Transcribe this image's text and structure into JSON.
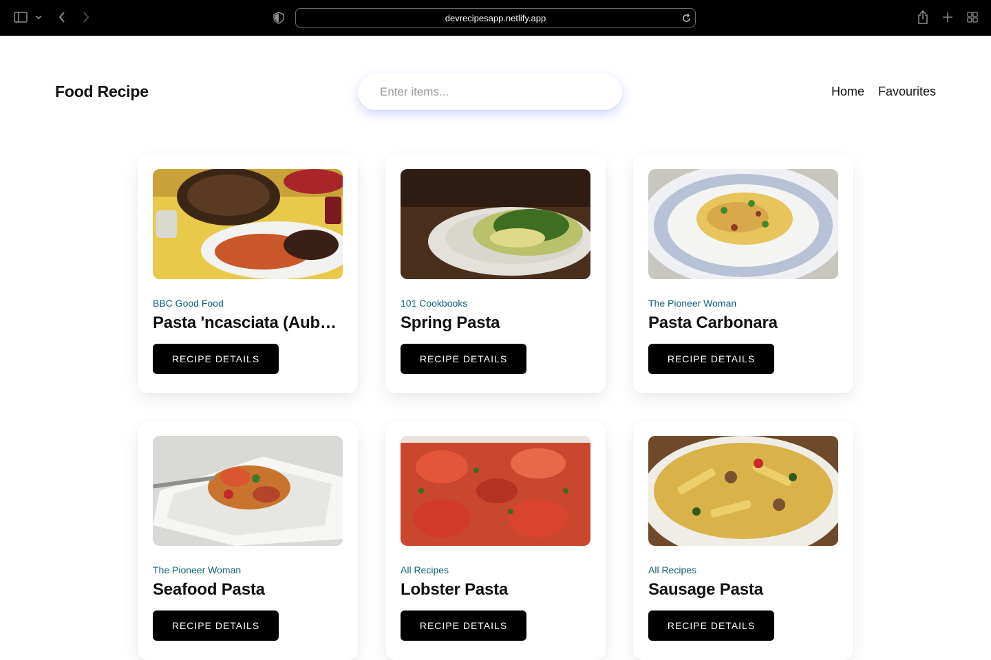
{
  "browser": {
    "url": "devrecipesapp.netlify.app",
    "icons": [
      "sidebar-icon",
      "chevron-down-icon",
      "back-icon",
      "forward-icon",
      "shield-icon",
      "reload-icon",
      "share-icon",
      "plus-icon",
      "tab-grid-icon"
    ]
  },
  "header": {
    "logo": "Food Recipe",
    "search_placeholder": "Enter items...",
    "nav": [
      "Home",
      "Favourites"
    ]
  },
  "recipes": [
    {
      "publisher": "BBC Good Food",
      "title": "Pasta 'ncasciata (Aube…",
      "button": "RECIPE DETAILS"
    },
    {
      "publisher": "101 Cookbooks",
      "title": "Spring Pasta",
      "button": "RECIPE DETAILS"
    },
    {
      "publisher": "The Pioneer Woman",
      "title": "Pasta Carbonara",
      "button": "RECIPE DETAILS"
    },
    {
      "publisher": "The Pioneer Woman",
      "title": "Seafood Pasta",
      "button": "RECIPE DETAILS"
    },
    {
      "publisher": "All Recipes",
      "title": "Lobster Pasta",
      "button": "RECIPE DETAILS"
    },
    {
      "publisher": "All Recipes",
      "title": "Sausage Pasta",
      "button": "RECIPE DETAILS"
    }
  ],
  "colors": {
    "publisher": "#11607a",
    "button_bg": "#000000",
    "chrome_bg": "#000000"
  }
}
